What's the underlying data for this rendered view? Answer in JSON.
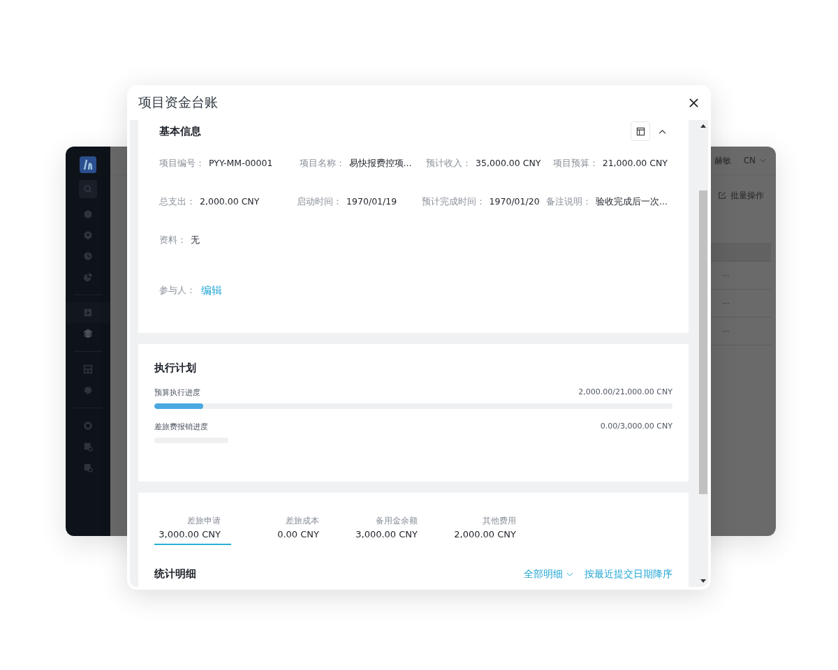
{
  "background_window": {
    "user_name": "赫敏",
    "language": "CN",
    "batch_action": "批量操作",
    "row_actions": [
      "···",
      "···",
      "···"
    ]
  },
  "dialog": {
    "title": "项目资金台账",
    "basic_info": {
      "title": "基本信息",
      "expanded": true,
      "rows": [
        [
          {
            "label": "项目编号：",
            "value": "PYY-MM-00001"
          },
          {
            "label": "项目名称：",
            "value": "易快报费控项..."
          },
          {
            "label": "预计收入：",
            "value": "35,000.00 CNY"
          },
          {
            "label": "项目预算：",
            "value": "21,000.00 CNY"
          }
        ],
        [
          {
            "label": "总支出：",
            "value": "2,000.00 CNY"
          },
          {
            "label": "启动时间：",
            "value": "1970/01/19"
          },
          {
            "label": "预计完成时间：",
            "value": "1970/01/20"
          },
          {
            "label": "备注说明：",
            "value": "验收完成后一次..."
          }
        ],
        [
          {
            "label": "资料：",
            "value": "无"
          }
        ]
      ],
      "participants": {
        "label": "参与人：",
        "action": "编辑"
      }
    },
    "plan": {
      "title": "执行计划",
      "bars": [
        {
          "label": "预算执行进度",
          "reading": "2,000.00/21,000.00 CNY",
          "level": 0.095
        },
        {
          "label": "差旅费报销进度",
          "reading": "0.00/3,000.00 CNY",
          "level": 0
        }
      ]
    },
    "stats": {
      "tabs": [
        {
          "label": "差旅申请",
          "value": "3,000.00 CNY",
          "selected": true
        },
        {
          "label": "差旅成本",
          "value": "0.00 CNY",
          "selected": false
        },
        {
          "label": "备用金余额",
          "value": "3,000.00 CNY",
          "selected": false
        },
        {
          "label": "其他费用",
          "value": "2,000.00 CNY",
          "selected": false
        }
      ],
      "title": "统计明细",
      "filter": "全部明细",
      "sort": "按最近提交日期降序"
    }
  }
}
